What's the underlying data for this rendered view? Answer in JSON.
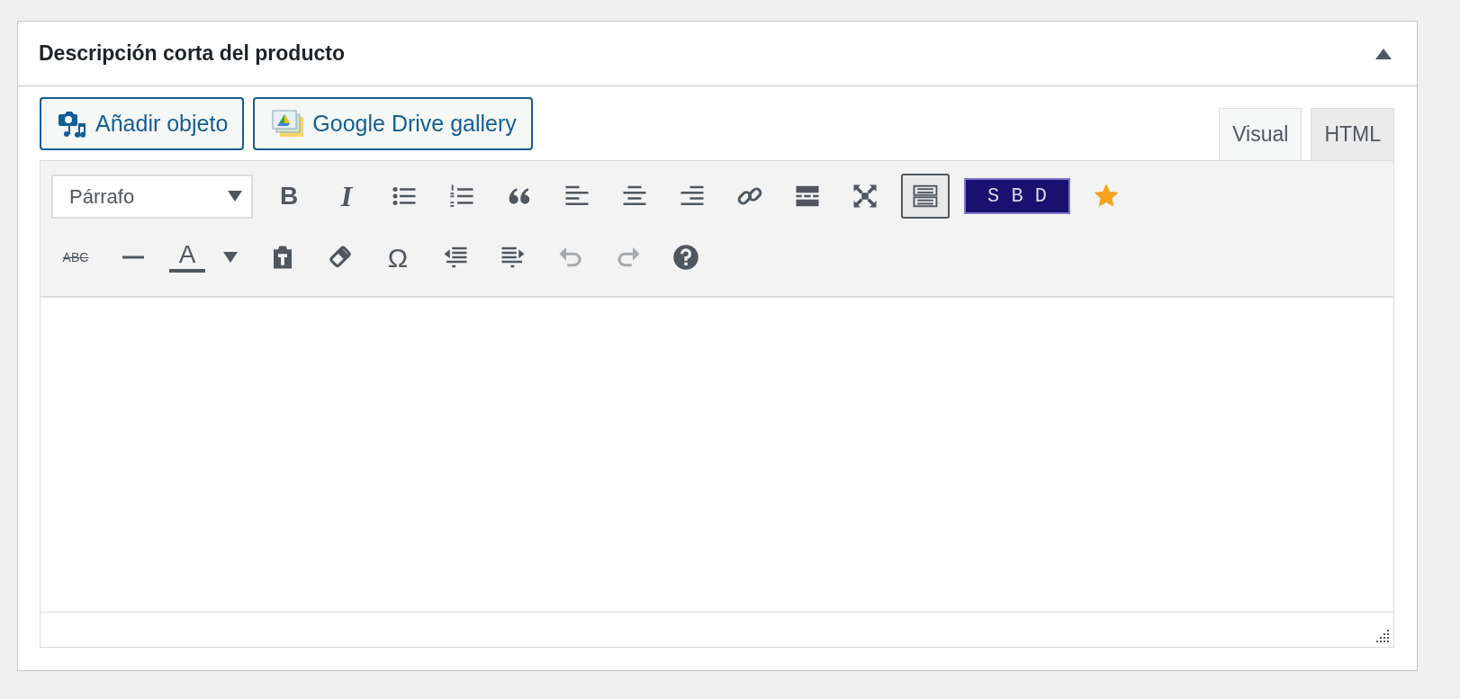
{
  "panel": {
    "title": "Descripción corta del producto"
  },
  "media_buttons": [
    {
      "label": "Añadir objeto"
    },
    {
      "label": "Google Drive gallery"
    }
  ],
  "tabs": [
    {
      "label": "Visual",
      "selected": true
    },
    {
      "label": "HTML",
      "selected": false
    }
  ],
  "toolbar_rows": [
    [
      {
        "kind": "select",
        "value": "Párrafo"
      },
      {
        "kind": "glyph",
        "label": "B",
        "active": false,
        "disabled": false
      },
      {
        "kind": "glyph",
        "label": "I",
        "active": false,
        "disabled": false
      },
      {
        "kind": "icon",
        "active": false,
        "disabled": false
      },
      {
        "kind": "icon",
        "active": false,
        "disabled": false
      },
      {
        "kind": "icon",
        "active": false,
        "disabled": false
      },
      {
        "kind": "icon",
        "active": false,
        "disabled": false
      },
      {
        "kind": "icon",
        "active": false,
        "disabled": false
      },
      {
        "kind": "icon",
        "active": false,
        "disabled": false
      },
      {
        "kind": "icon",
        "active": false,
        "disabled": false
      },
      {
        "kind": "icon",
        "active": false,
        "disabled": false
      },
      {
        "kind": "icon",
        "active": false,
        "disabled": false
      },
      {
        "kind": "icon",
        "active": true,
        "disabled": false
      },
      {
        "kind": "badge",
        "label": "S B D",
        "active": false,
        "disabled": false
      },
      {
        "kind": "icon",
        "active": false,
        "disabled": false
      }
    ],
    [
      {
        "kind": "glyph",
        "label": "ABC",
        "active": false,
        "disabled": false
      },
      {
        "kind": "icon",
        "active": false,
        "disabled": false
      },
      {
        "kind": "color",
        "label": "A",
        "active": false,
        "disabled": false
      },
      {
        "kind": "icon",
        "active": false,
        "disabled": false
      },
      {
        "kind": "icon",
        "active": false,
        "disabled": false
      },
      {
        "kind": "glyph",
        "label": "Ω",
        "active": false,
        "disabled": false
      },
      {
        "kind": "icon",
        "active": false,
        "disabled": false
      },
      {
        "kind": "icon",
        "active": false,
        "disabled": false
      },
      {
        "kind": "icon",
        "active": false,
        "disabled": true
      },
      {
        "kind": "icon",
        "active": false,
        "disabled": true
      },
      {
        "kind": "icon",
        "active": false,
        "disabled": false
      }
    ]
  ]
}
